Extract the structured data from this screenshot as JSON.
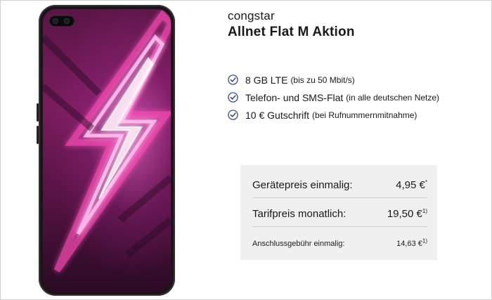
{
  "offer": {
    "brand": "congstar",
    "tariff_name": "Allnet Flat M Aktion"
  },
  "features": [
    {
      "main": "8 GB LTE",
      "note": "(bis zu 50 Mbit/s)"
    },
    {
      "main": "Telefon- und SMS-Flat",
      "note": "(in alle deutschen Netze)"
    },
    {
      "main": "10 € Gutschrift",
      "note": "(bei Rufnummernmitnahme)"
    }
  ],
  "prices": {
    "device": {
      "label": "Gerätepreis einmalig:",
      "value": "4,95 €",
      "mark": "*"
    },
    "monthly": {
      "label": "Tarifpreis monatlich:",
      "value": "19,50 €",
      "mark": "1)"
    },
    "connection": {
      "label": "Anschlussgebühr einmalig:",
      "value": "14,63 €",
      "mark": "1)"
    }
  },
  "colors": {
    "check_icon": "#2b3f8c",
    "price_box_bg": "#f0f0f0",
    "screen_glow": "#ff78dc"
  },
  "icons": {
    "feature_bullet": "check-circle-icon"
  }
}
